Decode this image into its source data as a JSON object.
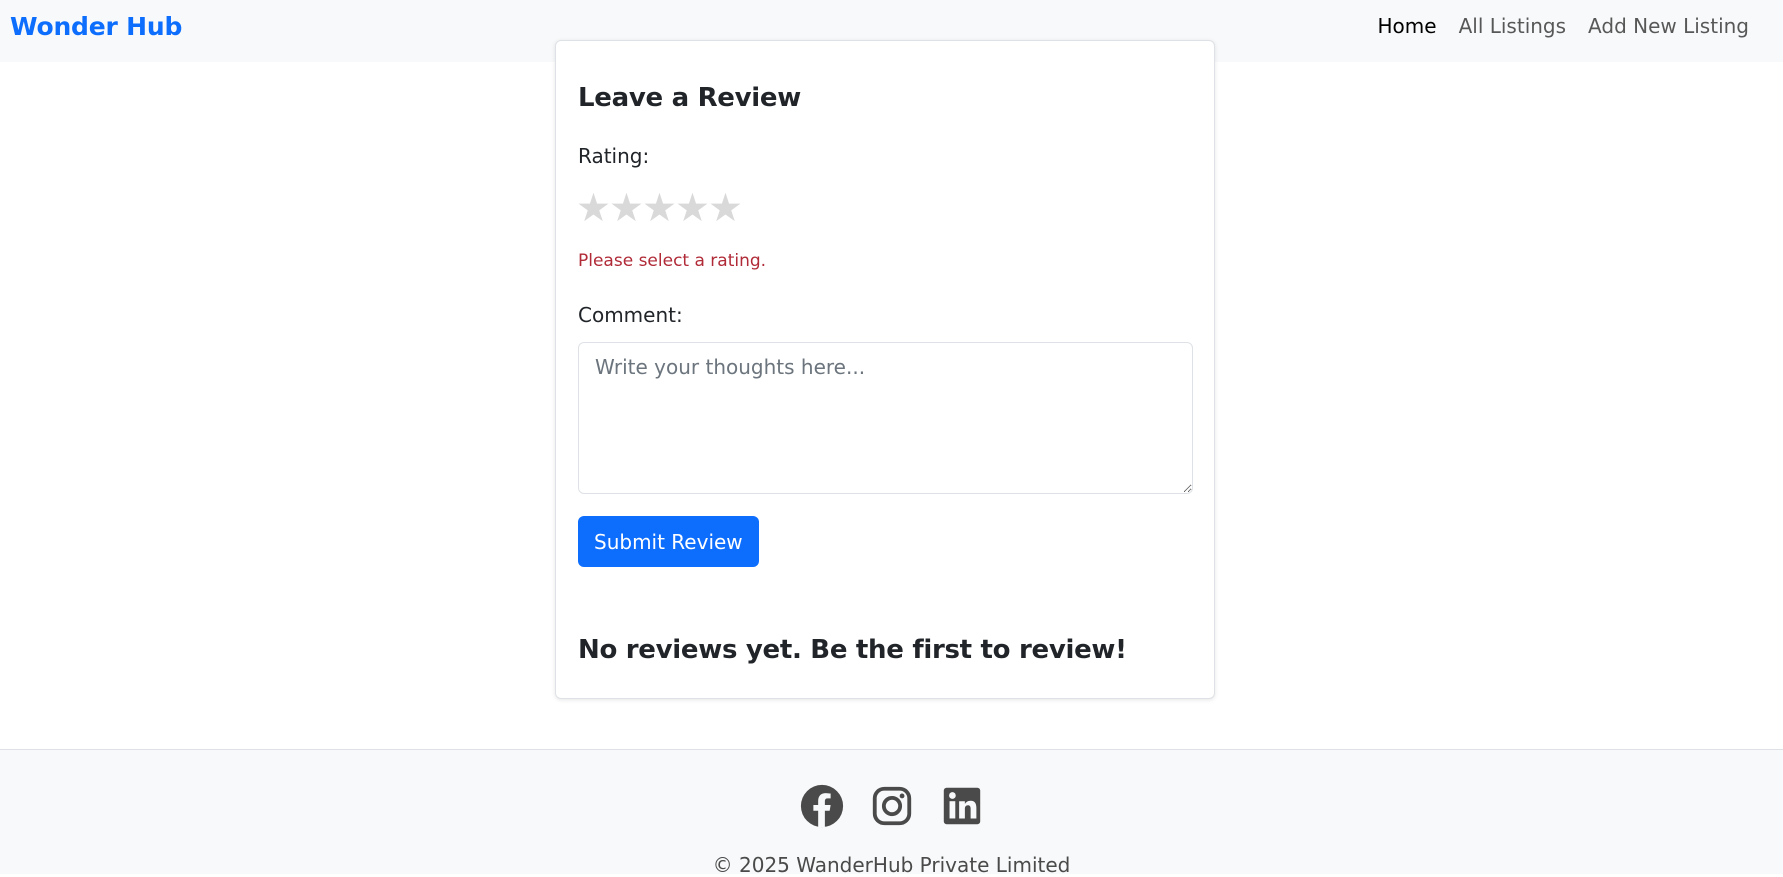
{
  "navbar": {
    "brand": "Wonder Hub",
    "links": [
      {
        "label": "Home",
        "active": true
      },
      {
        "label": "All Listings",
        "active": false
      },
      {
        "label": "Add New Listing",
        "active": false
      }
    ]
  },
  "review_form": {
    "heading": "Leave a Review",
    "rating_label": "Rating:",
    "stars": [
      "★",
      "★",
      "★",
      "★",
      "★"
    ],
    "selected_rating": 0,
    "rating_error": "Please select a rating.",
    "comment_label": "Comment:",
    "comment_placeholder": "Write your thoughts here...",
    "comment_value": "",
    "submit_label": "Submit Review"
  },
  "reviews": {
    "empty_message": "No reviews yet. Be the first to review!"
  },
  "footer": {
    "social_icons": [
      "facebook-icon",
      "instagram-icon",
      "linkedin-icon"
    ],
    "copyright": "© 2025 WanderHub Private Limited"
  },
  "colors": {
    "brand": "#0d6efd",
    "button": "#0d6efd",
    "error": "#b02a37",
    "star_empty": "#d9d9d9",
    "icon": "#4a4a4a"
  }
}
